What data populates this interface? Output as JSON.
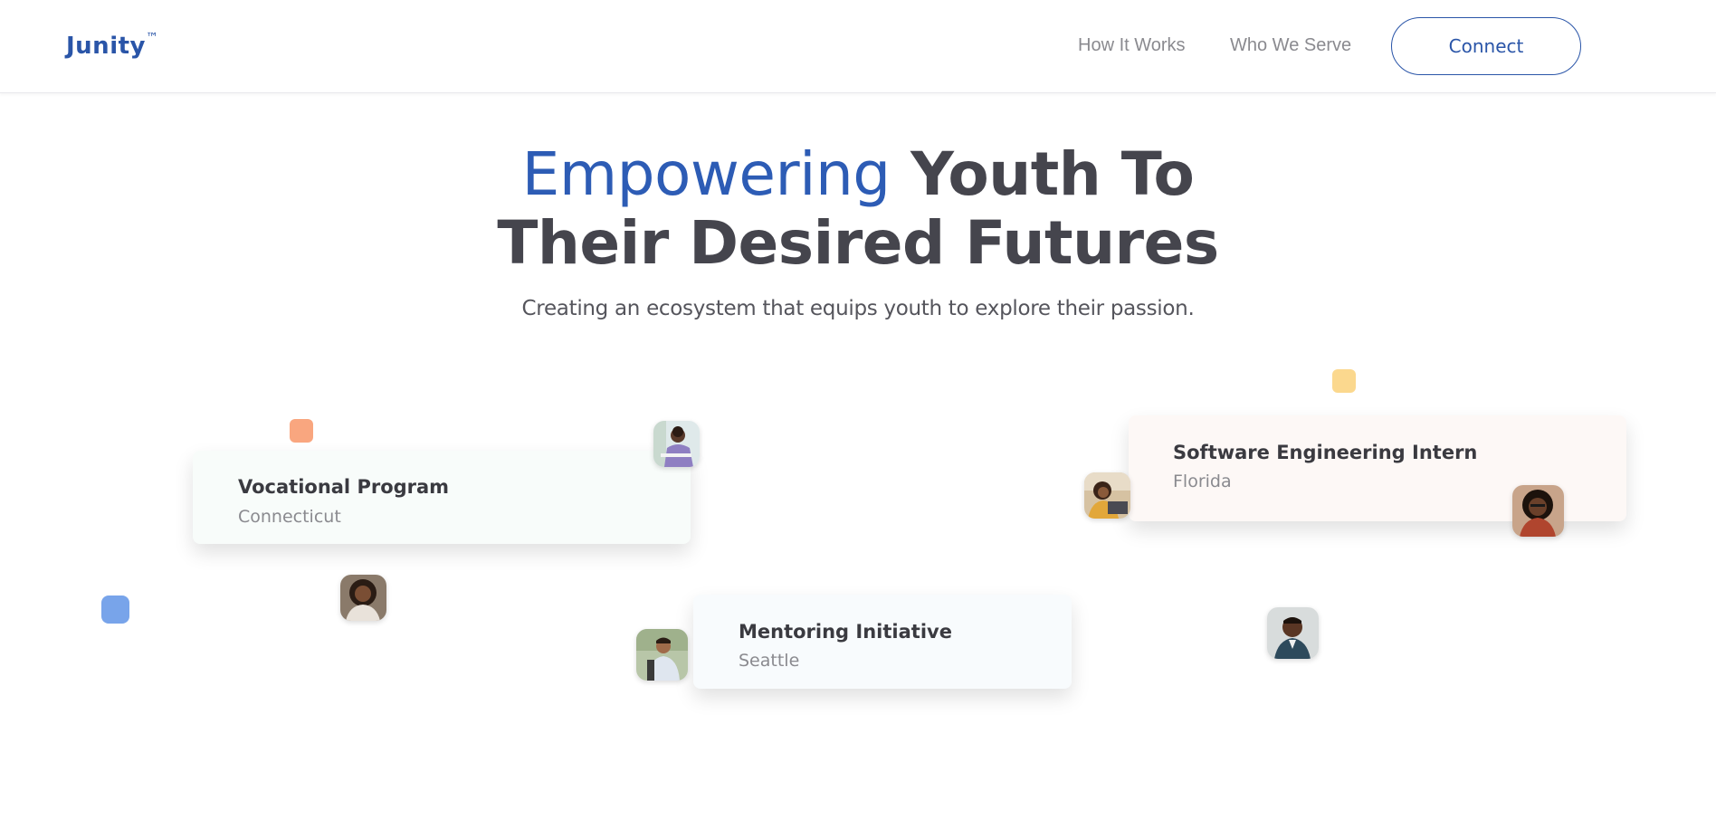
{
  "header": {
    "logo": "Junity",
    "logo_mark": "™",
    "nav": {
      "how_it_works": "How It Works",
      "who_we_serve": "Who We Serve"
    },
    "connect_label": "Connect"
  },
  "hero": {
    "title_accent": "Empowering",
    "title_line1_rest": " Youth To",
    "title_line2": "Their Desired Futures",
    "subtitle": "Creating an ecosystem that equips youth to explore their passion."
  },
  "cards": {
    "vocational": {
      "title": "Vocational Program",
      "location": "Connecticut"
    },
    "software": {
      "title": "Software Engineering Intern",
      "location": "Florida"
    },
    "mentoring": {
      "title": "Mentoring Initiative",
      "location": "Seattle"
    }
  },
  "colors": {
    "brand": "#2a55a8",
    "accent_orange": "#f9a67f",
    "accent_blue": "#78a4ea",
    "accent_yellow": "#fbd88e"
  }
}
